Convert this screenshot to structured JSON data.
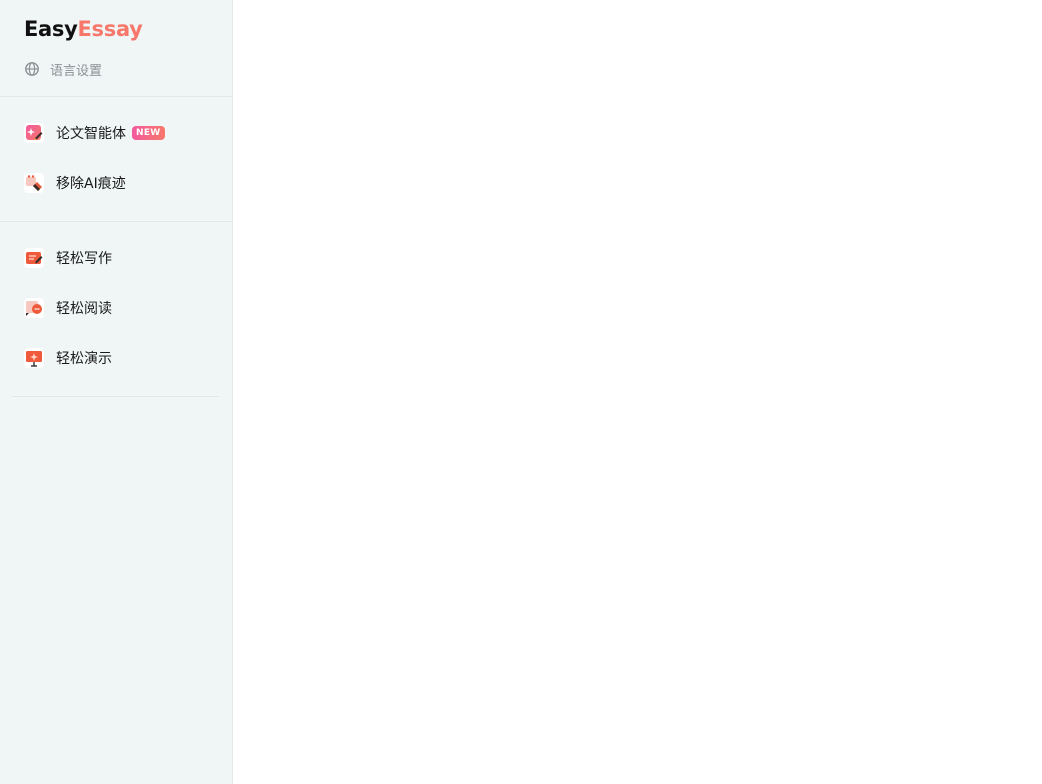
{
  "brand": {
    "part1": "Easy",
    "part2": "Essay",
    "color_dark": "#111111",
    "color_accent": "#f7786b"
  },
  "language": {
    "icon": "globe-icon",
    "label": "语言设置"
  },
  "nav_group_1": [
    {
      "label": "论文智能体",
      "icon": "sparkle-pen-icon",
      "badge": "NEW"
    },
    {
      "label": "移除AI痕迹",
      "icon": "eraser-icon"
    }
  ],
  "nav_group_2": [
    {
      "label": "轻松写作",
      "icon": "writing-icon"
    },
    {
      "label": "轻松阅读",
      "icon": "reading-chat-icon"
    },
    {
      "label": "轻松演示",
      "icon": "presentation-icon"
    }
  ],
  "colors": {
    "sidebar_bg": "#f0f5f5",
    "badge_gradient_start": "#f25a9e",
    "badge_gradient_end": "#f7786b"
  }
}
